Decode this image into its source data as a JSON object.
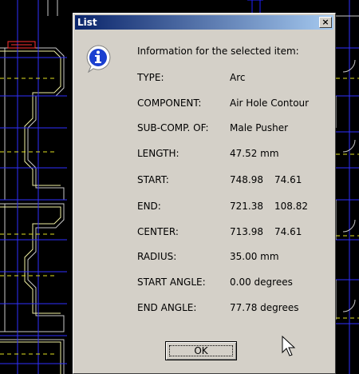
{
  "dialog": {
    "title": "List",
    "close_glyph": "×",
    "header": "Information for the selected item:",
    "rows": [
      {
        "label": "TYPE:",
        "value": "Arc"
      },
      {
        "label": "COMPONENT:",
        "value": "Air Hole Contour"
      },
      {
        "label": "SUB-COMP. OF:",
        "value": "Male Pusher"
      },
      {
        "label": "LENGTH:",
        "value": "47.52 mm"
      },
      {
        "label": "START:",
        "value": "748.98",
        "value2": "74.61"
      },
      {
        "label": "END:",
        "value": "721.38",
        "value2": "108.82"
      },
      {
        "label": "CENTER:",
        "value": "713.98",
        "value2": "74.61"
      },
      {
        "label": "RADIUS:",
        "value": "35.00 mm"
      },
      {
        "label": "START ANGLE:",
        "value": "0.00 degrees"
      },
      {
        "label": "END ANGLE:",
        "value": "77.78 degrees"
      }
    ],
    "ok_label": "OK"
  },
  "icons": {
    "dialog_icon": "info-icon",
    "pointer": "mouse-pointer-icon"
  },
  "colors": {
    "cad_background": "#000000",
    "dialog_face": "#d4d0c8",
    "titlebar_start": "#0a246a",
    "titlebar_end": "#a6caf0"
  }
}
